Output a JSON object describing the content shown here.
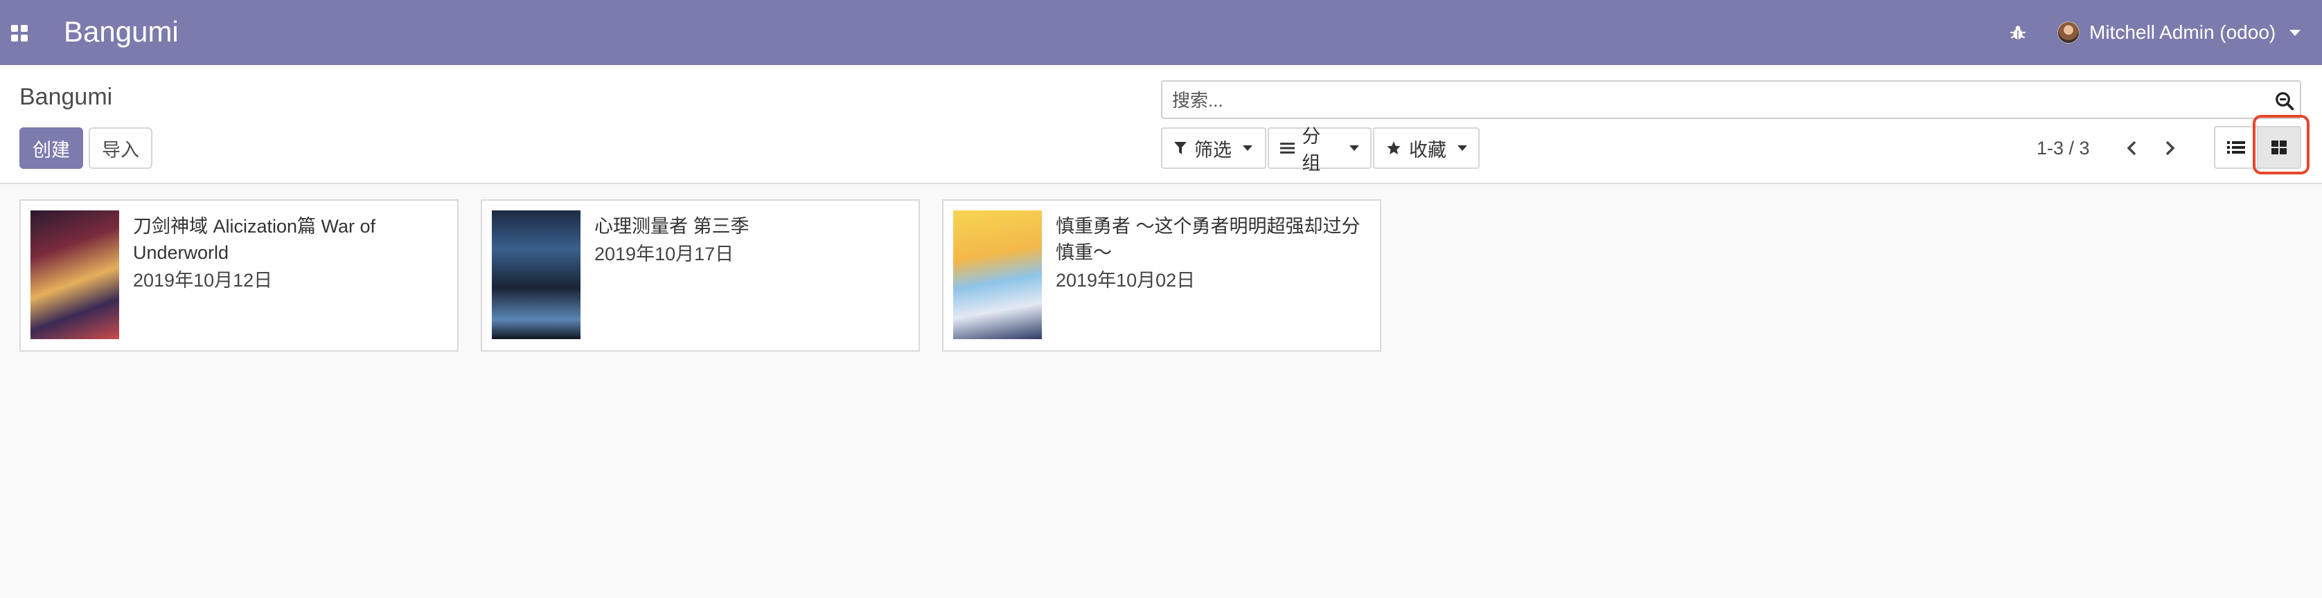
{
  "navbar": {
    "brand": "Bangumi",
    "user_name": "Mitchell Admin (odoo)",
    "colors": {
      "navbar_bg": "#7c7bad"
    },
    "icons": {
      "apps": "apps-grid-icon",
      "debug": "bug-icon",
      "avatar": "user-avatar"
    }
  },
  "control_panel": {
    "breadcrumb": "Bangumi",
    "create_label": "创建",
    "import_label": "导入",
    "search_placeholder": "搜索...",
    "filter_label": "筛选",
    "group_label": "分组",
    "favorites_label": "收藏",
    "pager_value": "1-3 / 3",
    "active_view": "kanban"
  },
  "records": [
    {
      "title": "刀剑神域 Alicization篇 War of Underworld",
      "date": "2019年10月12日"
    },
    {
      "title": "心理测量者 第三季",
      "date": "2019年10月17日"
    },
    {
      "title": "慎重勇者 ～这个勇者明明超强却过分慎重～",
      "date": "2019年10月02日"
    }
  ]
}
